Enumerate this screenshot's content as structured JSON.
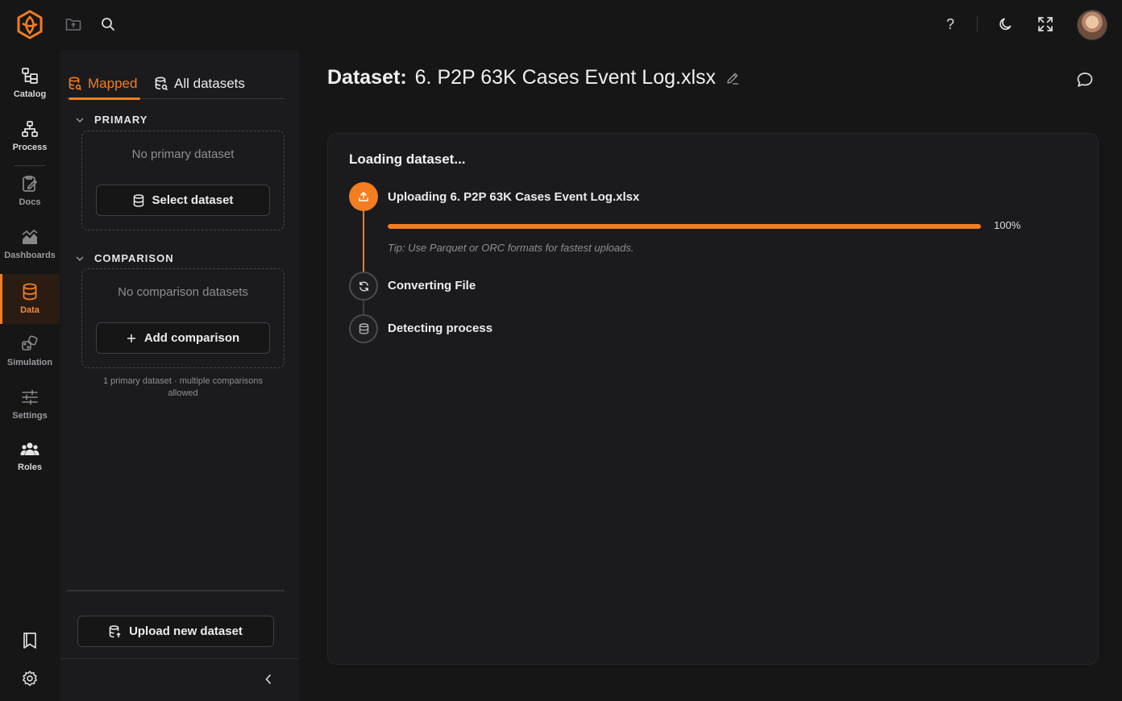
{
  "brand": {
    "accent": "#f47d20",
    "logo_icon": "hexagon-flower-logo-icon"
  },
  "topbar": {
    "icons": [
      "folder-upload-icon",
      "search-icon",
      "help-icon",
      "moon-icon",
      "fullscreen-icon"
    ],
    "help_label": "?"
  },
  "rail": {
    "items": [
      {
        "label": "Catalog",
        "icon": "catalog-icon"
      },
      {
        "label": "Process",
        "icon": "process-icon"
      },
      {
        "label": "Docs",
        "icon": "docs-icon"
      },
      {
        "label": "Dashboards",
        "icon": "dashboards-icon"
      },
      {
        "label": "Data",
        "icon": "database-icon"
      },
      {
        "label": "Simulation",
        "icon": "simulation-icon"
      },
      {
        "label": "Settings",
        "icon": "sliders-icon"
      },
      {
        "label": "Roles",
        "icon": "users-icon"
      }
    ],
    "active": "Data"
  },
  "sidebar": {
    "tabs": [
      {
        "label": "Mapped",
        "active": true
      },
      {
        "label": "All datasets",
        "active": false
      }
    ],
    "primary": {
      "heading": "PRIMARY",
      "empty_text": "No primary dataset",
      "button_label": "Select dataset"
    },
    "comparison": {
      "heading": "COMPARISON",
      "empty_text": "No comparison datasets",
      "button_label": "Add comparison"
    },
    "hint": "1 primary dataset · multiple comparisons allowed",
    "upload_label": "Upload new dataset"
  },
  "main": {
    "title_prefix": "Dataset:",
    "title_name": "6. P2P 63K Cases Event Log.xlsx",
    "card_title": "Loading dataset...",
    "steps": [
      {
        "label": "Uploading 6. P2P 63K Cases Event Log.xlsx",
        "status": "done",
        "icon": "upload-icon"
      },
      {
        "label": "Converting File",
        "status": "pending",
        "icon": "refresh-icon"
      },
      {
        "label": "Detecting process",
        "status": "pending",
        "icon": "database-icon"
      }
    ],
    "progress": {
      "value": 1.0,
      "label": "100%"
    },
    "tip": "Tip: Use Parquet or ORC formats for fastest uploads."
  }
}
